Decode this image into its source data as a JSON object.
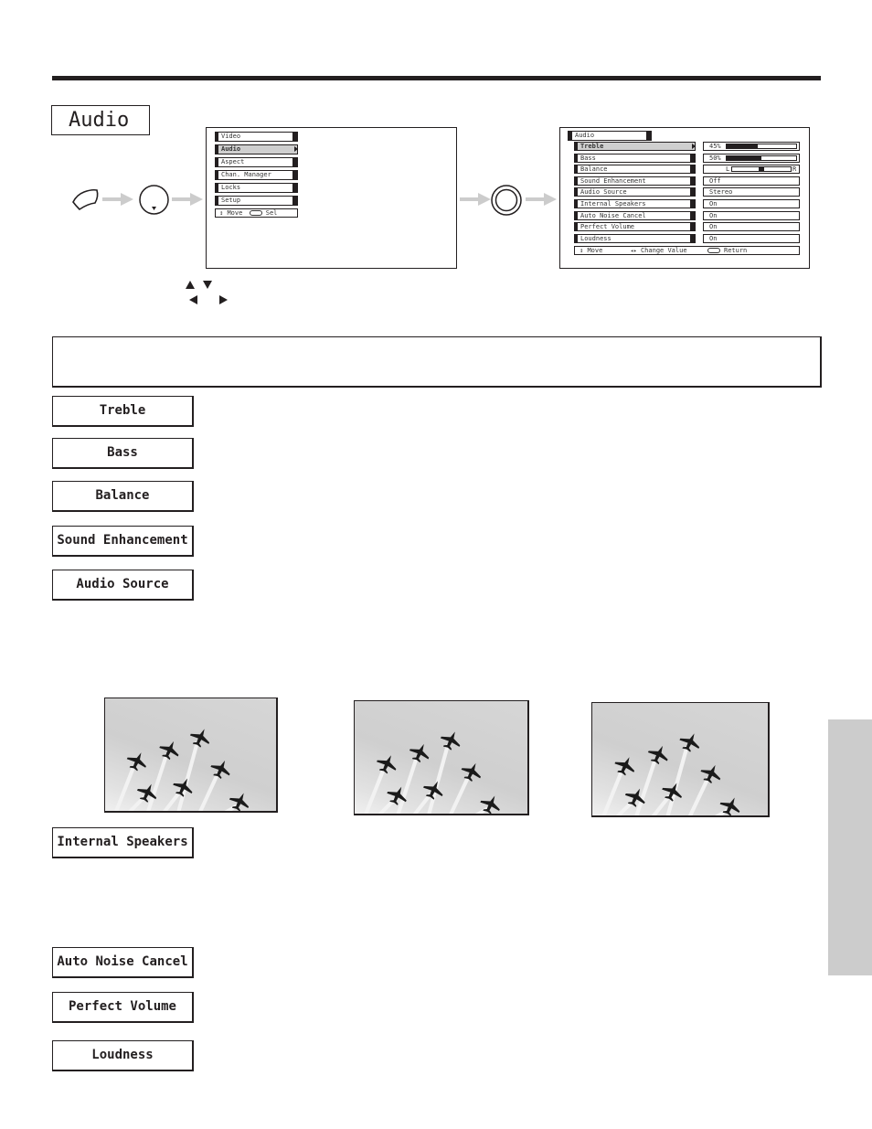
{
  "section": {
    "title": "Audio"
  },
  "flow": {
    "step1_icon": "menu-button-icon",
    "step2_icon": "thumbstick-down-icon",
    "step3_icon": "select-button-icon",
    "arrow_icon": "arrow-right-icon"
  },
  "main_menu": {
    "items": [
      {
        "label": "Video"
      },
      {
        "label": "Audio",
        "selected": true
      },
      {
        "label": "Aspect"
      },
      {
        "label": "Chan. Manager"
      },
      {
        "label": "Locks"
      },
      {
        "label": "Setup"
      }
    ],
    "footer": {
      "move": "Move",
      "select": "Sel"
    }
  },
  "audio_menu": {
    "title": "Audio",
    "items": [
      {
        "label": "Treble",
        "value": "45%",
        "type": "bar",
        "level": 0.45,
        "selected": true
      },
      {
        "label": "Bass",
        "value": "50%",
        "type": "bar",
        "level": 0.5
      },
      {
        "label": "Balance",
        "type": "balance",
        "left": "L",
        "right": "R",
        "level": 0.5
      },
      {
        "label": "Sound Enhancement",
        "value": "Off"
      },
      {
        "label": "Audio Source",
        "value": "Stereo"
      },
      {
        "label": "Internal Speakers",
        "value": "On"
      },
      {
        "label": "Auto Noise Cancel",
        "value": "On"
      },
      {
        "label": "Perfect Volume",
        "value": "On"
      },
      {
        "label": "Loudness",
        "value": "On"
      }
    ],
    "footer": {
      "move": "Move",
      "change": "Change Value",
      "return": "Return"
    }
  },
  "key_legend": {
    "up_down": "up-down-arrow-keys-icon",
    "left_right": "left-right-arrow-keys-icon"
  },
  "features": [
    {
      "label": "Treble"
    },
    {
      "label": "Bass"
    },
    {
      "label": "Balance"
    },
    {
      "label": "Sound Enhancement"
    },
    {
      "label": "Audio Source"
    },
    {
      "label": "Internal Speakers"
    },
    {
      "label": "Auto Noise Cancel"
    },
    {
      "label": "Perfect Volume"
    },
    {
      "label": "Loudness"
    }
  ],
  "photos": [
    {
      "subject": "jets-in-formation"
    },
    {
      "subject": "jets-in-formation"
    },
    {
      "subject": "jets-in-formation"
    }
  ],
  "colors": {
    "ink": "#231f20",
    "highlight": "#cfcfcf",
    "side_tab": "#cccccc",
    "arrow": "#cccccc"
  }
}
